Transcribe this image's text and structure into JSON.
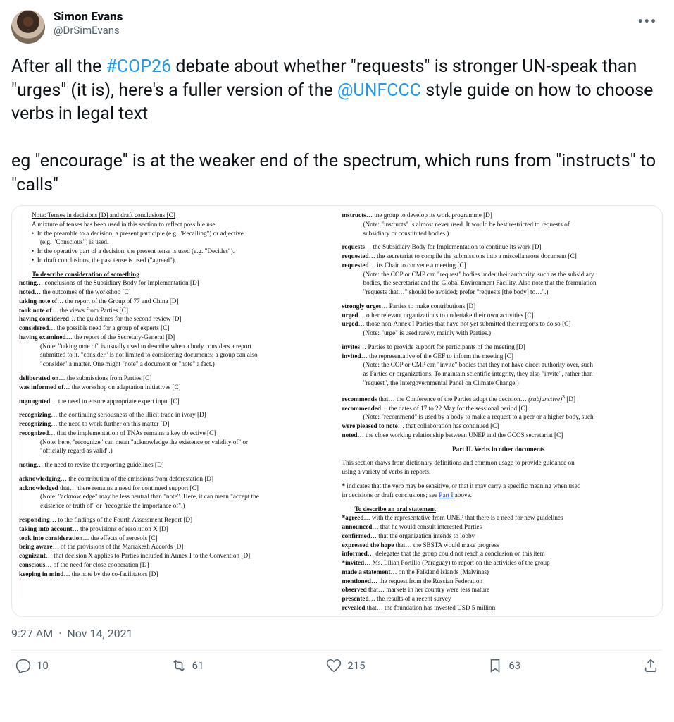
{
  "author": {
    "display_name": "Simon Evans",
    "handle": "@DrSimEvans"
  },
  "tweet": {
    "segments": [
      {
        "t": "After all the ",
        "type": "text"
      },
      {
        "t": "#COP26",
        "type": "link"
      },
      {
        "t": " debate about whether \"requests\" is stronger UN-speak than \"urges\" (it is), here's a fuller version of the ",
        "type": "text"
      },
      {
        "t": "@UNFCCC",
        "type": "link"
      },
      {
        "t": " style guide on how to choose verbs in legal text",
        "type": "text"
      },
      {
        "t": "\n\n",
        "type": "br2"
      },
      {
        "t": "eg \"encourage\" is at the weaker end of the spectrum, which runs from \"instructs\" to \"calls\"",
        "type": "text"
      }
    ]
  },
  "doc_left": [
    {
      "cls": "indent1",
      "html": "<span class='u'>Note:  Tenses in decisions [D] and draft conclusions [C]</span>"
    },
    {
      "cls": "indent1",
      "html": "A mixture of tenses has been used in this section to reflect possible use."
    },
    {
      "cls": "indent1",
      "html": "•&nbsp;&nbsp;In the preamble to a decision, a present participle (e.g. \"Recalling\") or adjective"
    },
    {
      "cls": "indent2",
      "html": "(e.g. \"Conscious\") is used."
    },
    {
      "cls": "indent1",
      "html": "•&nbsp;&nbsp;In the operative part of a decision, the present tense is used (e.g. \"Decides\")."
    },
    {
      "cls": "indent1",
      "html": "•&nbsp;&nbsp;In draft conclusions, the past tense is used (\"agreed\")."
    },
    {
      "cls": "gap"
    },
    {
      "cls": "indent1",
      "html": "<span class='u b'>To describe consideration of something</span>"
    },
    {
      "cls": "",
      "html": "<span class='b'>noting</span>… conclusions of the Subsidiary Body for Implementation [D]"
    },
    {
      "cls": "",
      "html": "<span class='b'>noted</span>… the outcomes of the workshop [C]"
    },
    {
      "cls": "",
      "html": "<span class='b'>taking note of</span>… the report of the Group of 77 and China [D]"
    },
    {
      "cls": "",
      "html": "<span class='b'>took note of</span>… the views from Parties [C]"
    },
    {
      "cls": "",
      "html": "<span class='b'>having considered</span>… the guidelines for the second review [D]"
    },
    {
      "cls": "",
      "html": "<span class='b'>considered</span>… the possible need for a group of experts [C]"
    },
    {
      "cls": "",
      "html": "<span class='b'>having examined</span>… the report of the Secretary-General [D]"
    },
    {
      "cls": "indent2",
      "html": "(Note:  \"taking note of\" is usually used to describe when a body considers a report"
    },
    {
      "cls": "indent2",
      "html": "submitted to it.  \"consider\" is not limited to considering documents; a group can also"
    },
    {
      "cls": "indent2",
      "html": "\"consider\" a matter.  One might \"note\" a document or \"note\" a fact.)"
    },
    {
      "cls": "gap"
    },
    {
      "cls": "",
      "html": "<span class='b'>deliberated on</span>… the submissions from Parties [C]"
    },
    {
      "cls": "",
      "html": "<span class='b'>was informed of</span>… the workshop on adaptation initiatives [C]"
    },
    {
      "cls": "gap"
    },
    {
      "cls": "",
      "html": "<span class='b'>nıgnııgnted</span>… tne need to ensure appropriate expert input [C]"
    },
    {
      "cls": "gap"
    },
    {
      "cls": "",
      "html": "<span class='b'>recognizing</span>… the continuing seriousness of the illicit trade in ivory [D]"
    },
    {
      "cls": "",
      "html": "<span class='b'>recognizing</span>… the need to work further on this matter [D]"
    },
    {
      "cls": "",
      "html": "<span class='b'>recognized</span>… that the implementation of TNAs remains a key objective [C]"
    },
    {
      "cls": "indent2",
      "html": "(Note:  here, \"recognize\" can mean \"acknowledge the existence or validity of\" or"
    },
    {
      "cls": "indent2",
      "html": "\"officially regard as valid\".)"
    },
    {
      "cls": "gap"
    },
    {
      "cls": "",
      "html": "<span class='b'>noting</span>… the need to revise the reporting guidelines [D]"
    },
    {
      "cls": "gap"
    },
    {
      "cls": "",
      "html": "<span class='b'>acknowledging</span>… the contribution of the emissions from deforestation [D]"
    },
    {
      "cls": "",
      "html": "<span class='b'>acknowledged</span> that… there remains a need for continued support [C]"
    },
    {
      "cls": "indent2",
      "html": "(Note:  \"acknowledge\" may be less neutral than \"note\".  Here, it can mean \"accept the"
    },
    {
      "cls": "indent2",
      "html": "existence or truth of\" or \"recognize the importance of\".)"
    },
    {
      "cls": "gap"
    },
    {
      "cls": "",
      "html": "<span class='b'>responding</span>… to the findings of the Fourth Assessment Report [D]"
    },
    {
      "cls": "",
      "html": "<span class='b'>taking into account</span>… the provisions of resolution X [D]"
    },
    {
      "cls": "",
      "html": "<span class='b'>took into consideration</span>… the effects of aerosols [C]"
    },
    {
      "cls": "",
      "html": "<span class='b'>being aware</span>… of the provisions of the Marrakesh Accords [D]"
    },
    {
      "cls": "",
      "html": "<span class='b'>cognizant</span>… that decision X applies to Parties included in Annex I to the Convention [D]"
    },
    {
      "cls": "",
      "html": "<span class='b'>conscious</span>… of the need for close cooperation [D]"
    },
    {
      "cls": "",
      "html": "<span class='b'>keeping in mind</span>… the note by the co-facilitators [D]"
    }
  ],
  "doc_right": [
    {
      "cls": "",
      "html": "<span class='b'>ınstructs</span>… tne group to develop its work programme [D]"
    },
    {
      "cls": "indent2",
      "html": "(Note:  \"instructs\" is almost never used.  It would be best restricted to requests of"
    },
    {
      "cls": "indent2",
      "html": "subsidiary or constituted bodies.)"
    },
    {
      "cls": "gap"
    },
    {
      "cls": "",
      "html": "<span class='b'>requests</span>… the Subsidiary Body for Implementation to continue its work [D]"
    },
    {
      "cls": "",
      "html": "<span class='b'>requested</span>… the secretariat to compile the submissions into a miscellaneous document [C]"
    },
    {
      "cls": "",
      "html": "<span class='b'>requested</span>… its Chair to convene a meeting [C]"
    },
    {
      "cls": "indent2",
      "html": "(Note:  the COP or CMP can \"request\" bodies under their authority, such as the subsidiary"
    },
    {
      "cls": "indent2",
      "html": "bodies, the secretariat and the Global Environment Facility.  Also note that the formulation"
    },
    {
      "cls": "indent2",
      "html": "\"requests that…\" should be avoided; prefer \"requests [the body] to…\".)"
    },
    {
      "cls": "gap"
    },
    {
      "cls": "",
      "html": "<span class='b'>strongly urges</span>… Parties to make contributions [D]"
    },
    {
      "cls": "",
      "html": "<span class='b'>urged</span>… other relevant organizations to undertake their own activities [C]"
    },
    {
      "cls": "",
      "html": "<span class='b'>urged</span>… those non-Annex I Parties that have not yet submitted their reports to do so [C]"
    },
    {
      "cls": "indent2",
      "html": "(Note:  \"urge\" is used rarely, mainly with Parties.)"
    },
    {
      "cls": "gap"
    },
    {
      "cls": "",
      "html": "<span class='b'>invites</span>… Parties to provide support for participants of the meeting [D]"
    },
    {
      "cls": "",
      "html": "<span class='b'>invited</span>… the representative of the GEF to inform the meeting [C]"
    },
    {
      "cls": "indent2",
      "html": "(Note:  the COP or CMP can \"invite\" bodies that they not have direct authority over, such"
    },
    {
      "cls": "indent2",
      "html": "as Parties or organizations.  To maintain scientific integrity, they also \"invite\", rather than"
    },
    {
      "cls": "indent2",
      "html": "\"request\", the Intergovernmental Panel on Climate Change.)"
    },
    {
      "cls": "gap"
    },
    {
      "cls": "",
      "html": "<span class='b'>recommends</span> that… the Conference of the Parties adopt the decision… <i>(subjunctive)</i><sup>3</sup> [D]"
    },
    {
      "cls": "",
      "html": "<span class='b'>recommended</span>… the dates of 17 to 22 May for the sessional period [C]"
    },
    {
      "cls": "indent2",
      "html": "(Note:  \"recommend\" is used by a body to make a request to a peer or a higher body, such"
    },
    {
      "cls": "",
      "html": "<span class='b'>were pleased to note</span>… that collaboration has continued [C]"
    },
    {
      "cls": "",
      "html": "<span class='b'>noted</span>… the close working relationship between UNEP and the GCOS secretariat [C]"
    },
    {
      "cls": "gap"
    },
    {
      "cls": "center",
      "html": "<span class='b'>Part II.  Verbs in other documents</span>"
    },
    {
      "cls": "gap"
    },
    {
      "cls": "",
      "html": "This section draws from dictionary definitions and common usage to provide guidance on"
    },
    {
      "cls": "",
      "html": "using a variety of verbs in reports."
    },
    {
      "cls": "gap"
    },
    {
      "cls": "",
      "html": "<span class='b'>*</span> indicates that the verb may be sensitive, or that it may carry a specific meaning when used"
    },
    {
      "cls": "",
      "html": "in decisions or draft conclusions; see <span class='doc-link'>Part I</span> above."
    },
    {
      "cls": "gap"
    },
    {
      "cls": "indent1",
      "html": "<span class='u b'>To describe an oral statement</span>"
    },
    {
      "cls": "",
      "html": "<span class='b'>*agreed</span>… with the representative from UNEP that there is a need for new guidelines"
    },
    {
      "cls": "",
      "html": "<span class='b'>announced</span>… that he would consult interested Parties"
    },
    {
      "cls": "",
      "html": "<span class='b'>confirmed</span>… that the organization intends to lobby"
    },
    {
      "cls": "",
      "html": "<span class='b'>expressed the hope</span> that… the SBSTA would make progress"
    },
    {
      "cls": "",
      "html": "<span class='b'>informed</span>… delegates that the group could not reach a conclusion on this item"
    },
    {
      "cls": "",
      "html": "<span class='b'>*invited</span>… Ms. Lilian Portillo (Paraguay) to report on the activities of the group"
    },
    {
      "cls": "",
      "html": "<span class='b'>made a statement</span>… on the Falkland Islands (Malvinas)"
    },
    {
      "cls": "",
      "html": "<span class='b'>mentioned</span>… the request from the Russian Federation"
    },
    {
      "cls": "",
      "html": "<span class='b'>observed</span> that… markets in her country were less mature"
    },
    {
      "cls": "",
      "html": "<span class='b'>presented</span>… the results of a recent survey"
    },
    {
      "cls": "",
      "html": "<span class='b'>revealed</span> that… the foundation has invested USD 5 million"
    }
  ],
  "meta": {
    "time": "9:27 AM",
    "date": "Nov 14, 2021"
  },
  "actions": {
    "replies": "10",
    "retweets": "61",
    "likes": "215",
    "bookmarks": "63"
  }
}
